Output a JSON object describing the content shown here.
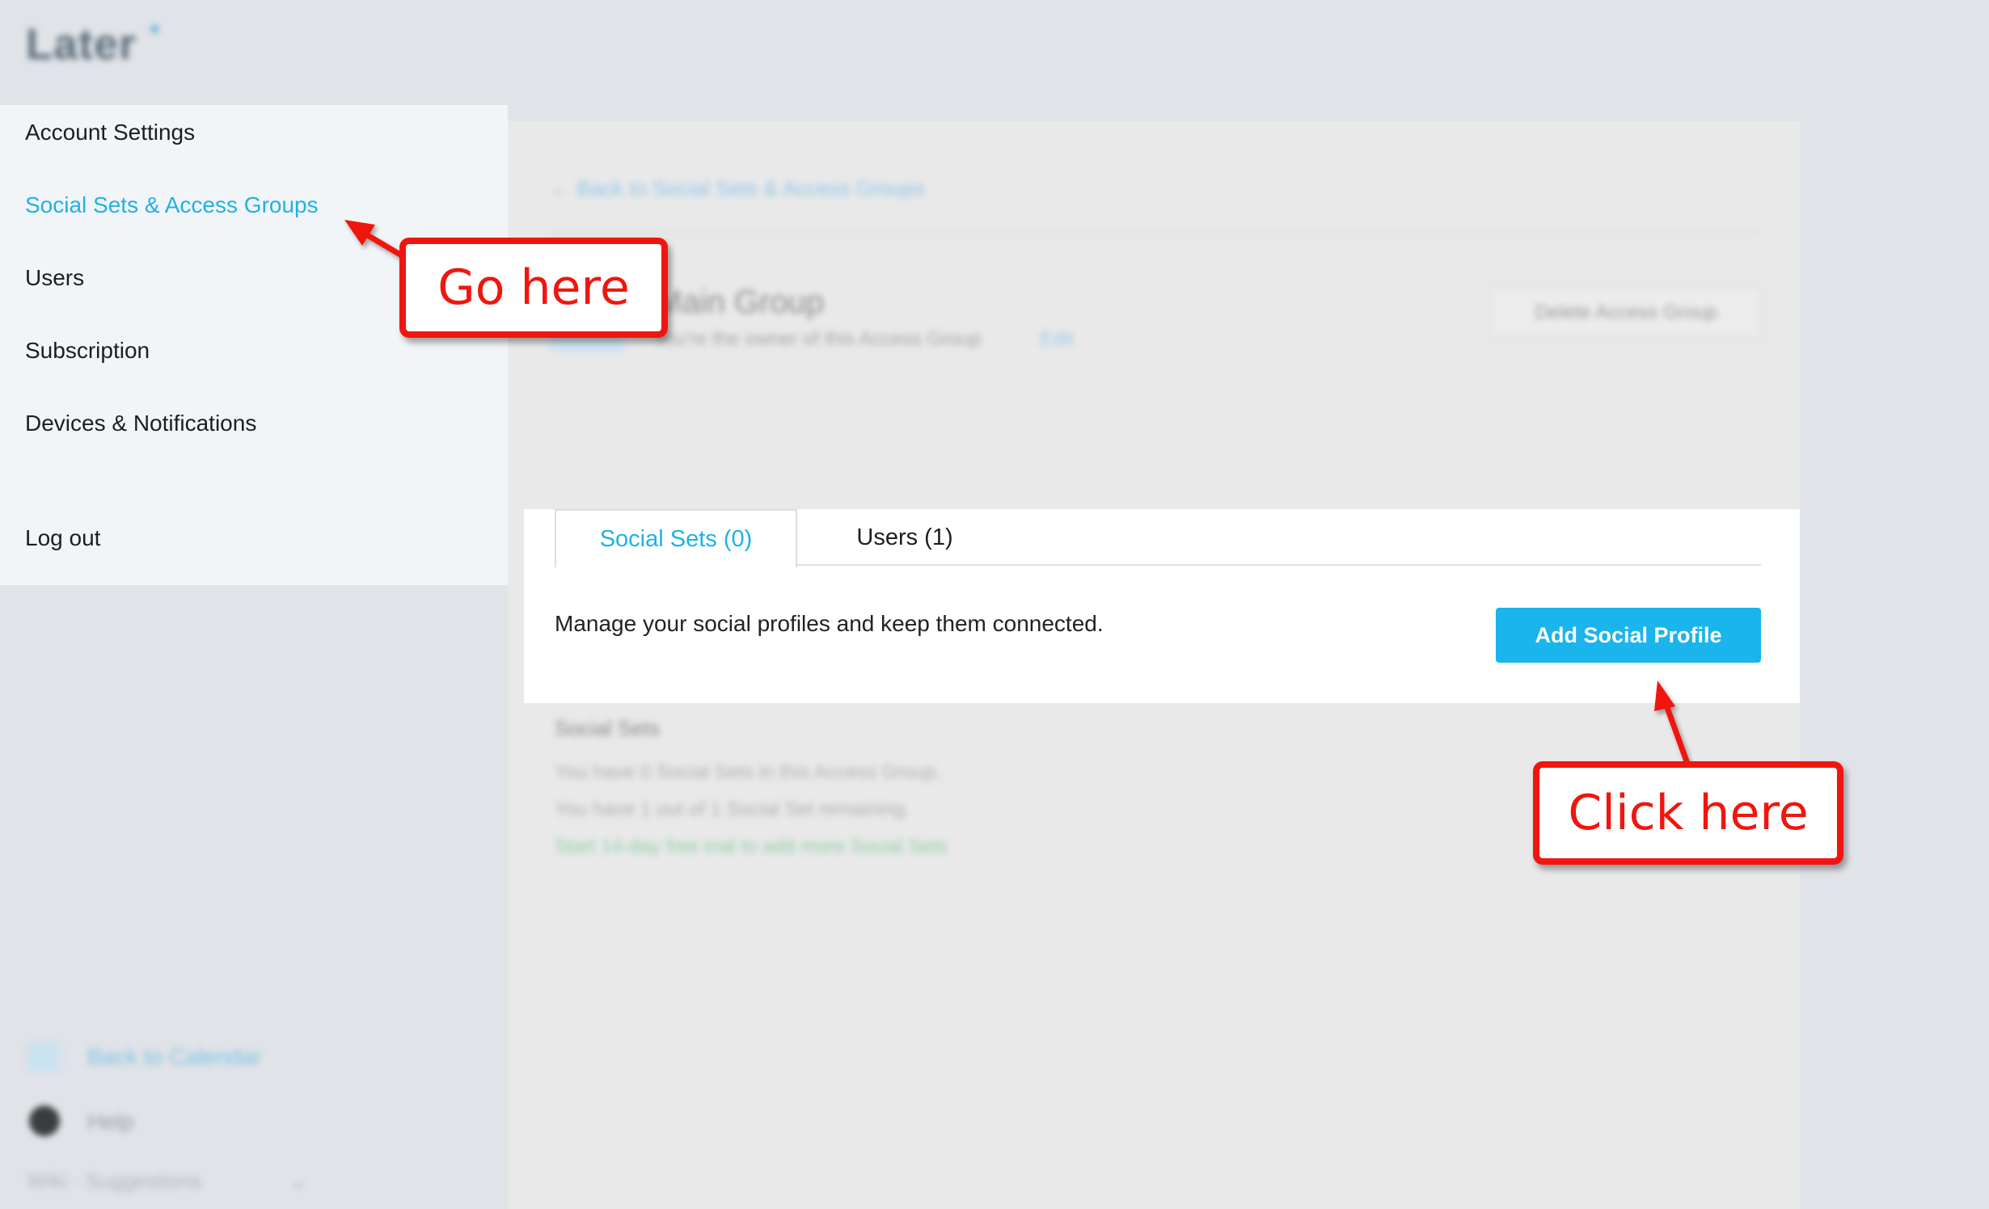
{
  "app": {
    "logo_text": "Later"
  },
  "sidebar": {
    "items": [
      {
        "label": "Account Settings"
      },
      {
        "label": "Social Sets & Access Groups"
      },
      {
        "label": "Users"
      },
      {
        "label": "Subscription"
      },
      {
        "label": "Devices & Notifications"
      },
      {
        "label": "Log out"
      }
    ],
    "footer": {
      "calendar": "Back to Calendar",
      "help": "Help",
      "suggestions": "Wiki · Suggestions"
    }
  },
  "main": {
    "back_link": "←  Back to Social Sets & Access Groups",
    "group": {
      "title": "Main Group",
      "owner_text": "You're the owner of this Access Group",
      "edit_label": "Edit",
      "delete_label": "Delete Access Group"
    },
    "tabs": [
      {
        "label": "Social Sets (0)",
        "active": true
      },
      {
        "label": "Users (1)",
        "active": false
      }
    ],
    "description": "Manage your social profiles and keep them connected.",
    "add_button": "Add Social Profile",
    "social_sets": {
      "heading": "Social Sets",
      "line1": "You have 0 Social Sets in this Access Group.",
      "line2": "You have 1 out of 1 Social Set remaining.",
      "line3": "Start 14-day free trial to add more Social Sets"
    }
  },
  "annotations": {
    "go_here": "Go here",
    "click_here": "Click here"
  },
  "colors": {
    "accent": "#1fb1e6",
    "button": "#19b5ec",
    "annotation": "#f0160f"
  }
}
